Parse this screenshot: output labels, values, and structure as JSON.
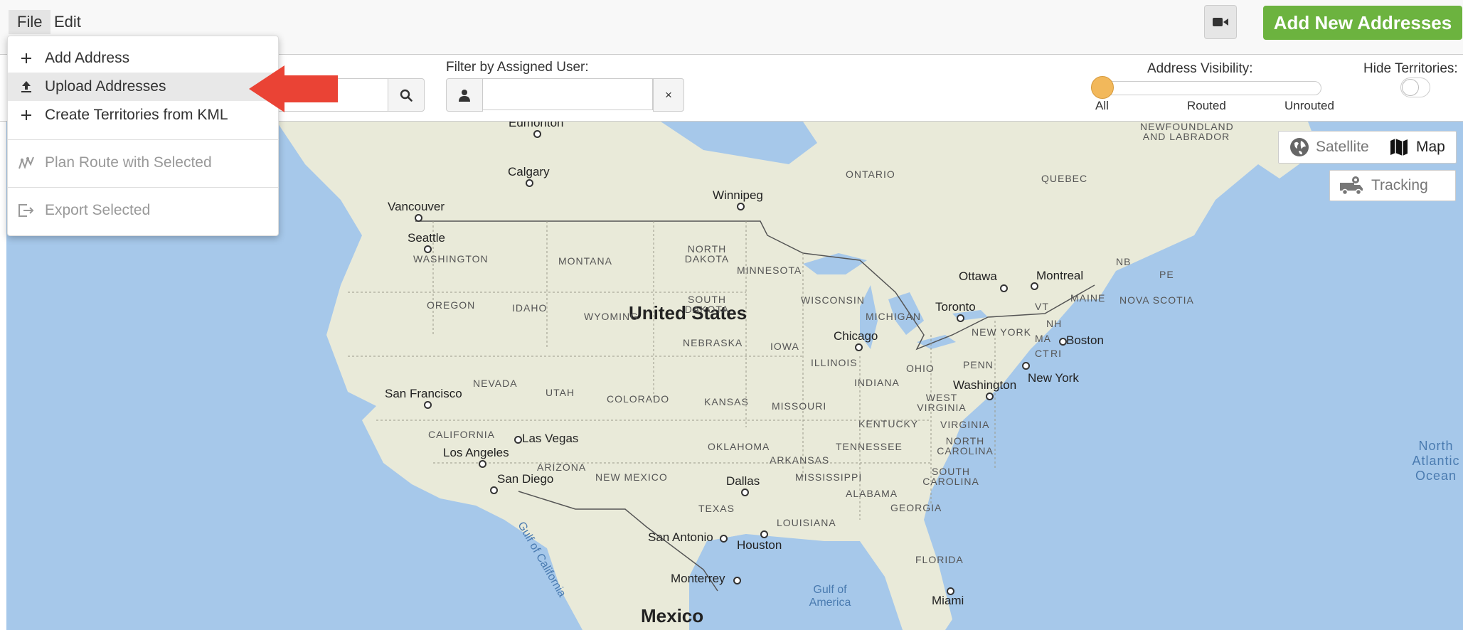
{
  "menubar": {
    "file_label": "File",
    "edit_label": "Edit",
    "add_new_label": "Add New Addresses",
    "camera_icon": "video-camera-icon"
  },
  "file_menu": {
    "items": [
      {
        "label": "Add Address",
        "icon": "plus-icon",
        "enabled": true
      },
      {
        "label": "Upload Addresses",
        "icon": "upload-icon",
        "enabled": true,
        "highlighted": true
      },
      {
        "label": "Create Territories from KML",
        "icon": "plus-icon",
        "enabled": true
      },
      {
        "label": "Plan Route with Selected",
        "icon": "route-icon",
        "enabled": false
      },
      {
        "label": "Export Selected",
        "icon": "export-icon",
        "enabled": false
      }
    ]
  },
  "filters": {
    "assigned_user_label": "Filter by Assigned User:",
    "assigned_user_value": "",
    "clear_label": "×",
    "visibility_label": "Address Visibility:",
    "visibility_options": [
      "All",
      "Routed",
      "Unrouted"
    ],
    "visibility_selected": "All",
    "hide_territories_label": "Hide Territories:",
    "hide_territories_on": false
  },
  "map_controls": {
    "satellite_label": "Satellite",
    "map_label": "Map",
    "selected_type": "Map",
    "tracking_label": "Tracking"
  },
  "map_labels": {
    "cities": [
      "Edmonton",
      "Calgary",
      "Vancouver",
      "Seattle",
      "Winnipeg",
      "Ottawa",
      "Montreal",
      "Toronto",
      "Boston",
      "New York",
      "Washington",
      "Chicago",
      "San Francisco",
      "Las Vegas",
      "Los Angeles",
      "San Diego",
      "Dallas",
      "San Antonio",
      "Houston",
      "Monterrey",
      "Miami"
    ],
    "states": [
      "WASHINGTON",
      "MONTANA",
      "NORTH DAKOTA",
      "MINNESOTA",
      "OREGON",
      "IDAHO",
      "WYOMING",
      "SOUTH DAKOTA",
      "WISCONSIN",
      "MICHIGAN",
      "NEBRASKA",
      "IOWA",
      "ILLINOIS",
      "INDIANA",
      "OHIO",
      "PENN",
      "NEW YORK",
      "NEVADA",
      "UTAH",
      "COLORADO",
      "KANSAS",
      "MISSOURI",
      "WEST VIRGINIA",
      "VIRGINIA",
      "KENTUCKY",
      "CALIFORNIA",
      "ARIZONA",
      "NEW MEXICO",
      "OKLAHOMA",
      "ARKANSAS",
      "TENNESSEE",
      "NORTH CAROLINA",
      "SOUTH CAROLINA",
      "MISSISSIPPI",
      "ALABAMA",
      "GEORGIA",
      "TEXAS",
      "LOUISIANA",
      "FLORIDA",
      "MAINE",
      "VT",
      "NH",
      "MA",
      "CT",
      "RI"
    ],
    "provinces": [
      "ONTARIO",
      "QUEBEC",
      "NEWFOUNDLAND AND LABRADOR",
      "NB",
      "PE",
      "NOVA SCOTIA"
    ],
    "countries": [
      "United States",
      "Mexico"
    ],
    "water": [
      "Gulf of California",
      "Gulf of America",
      "North Atlantic Ocean"
    ]
  }
}
